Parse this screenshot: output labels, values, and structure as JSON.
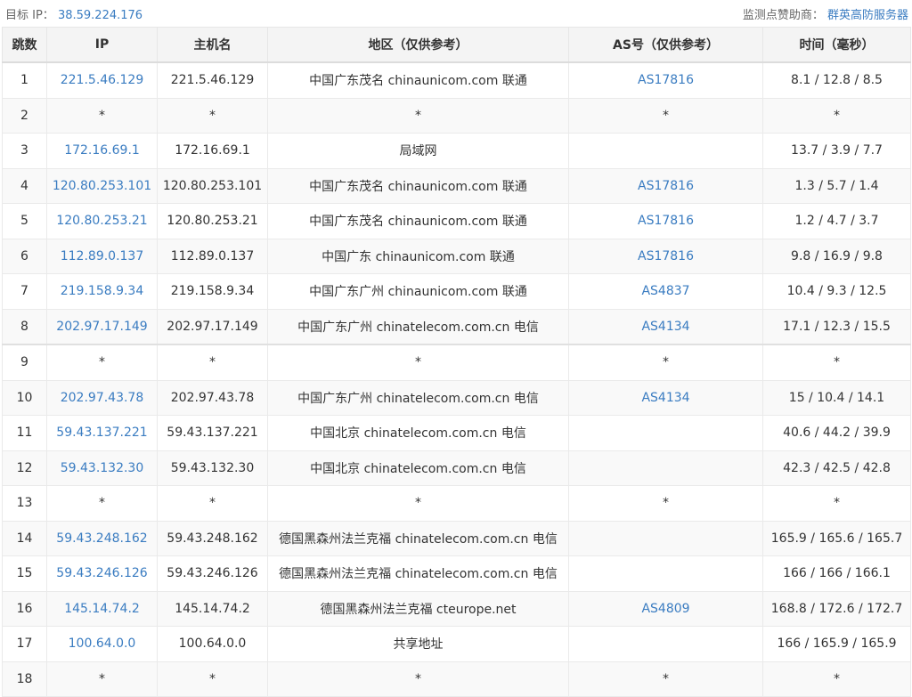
{
  "header": {
    "target_label": "目标 IP：",
    "target_ip": "38.59.224.176",
    "sponsor_label": "监测点赞助商：",
    "sponsor_name": "群英高防服务器"
  },
  "table": {
    "columns": [
      "跳数",
      "IP",
      "主机名",
      "地区（仅供参考）",
      "AS号（仅供参考）",
      "时间（毫秒）"
    ],
    "rows": [
      {
        "hop": "1",
        "ip": "221.5.46.129",
        "host": "221.5.46.129",
        "region": "中国广东茂名 chinaunicom.com 联通",
        "as": "AS17816",
        "time": "8.1 / 12.8 / 8.5"
      },
      {
        "hop": "2",
        "ip": "*",
        "host": "*",
        "region": "*",
        "as": "*",
        "time": "*"
      },
      {
        "hop": "3",
        "ip": "172.16.69.1",
        "host": "172.16.69.1",
        "region": "局域网",
        "as": "",
        "time": "13.7 / 3.9 / 7.7"
      },
      {
        "hop": "4",
        "ip": "120.80.253.101",
        "host": "120.80.253.101",
        "region": "中国广东茂名 chinaunicom.com 联通",
        "as": "AS17816",
        "time": "1.3 / 5.7 / 1.4"
      },
      {
        "hop": "5",
        "ip": "120.80.253.21",
        "host": "120.80.253.21",
        "region": "中国广东茂名 chinaunicom.com 联通",
        "as": "AS17816",
        "time": "1.2 / 4.7 / 3.7"
      },
      {
        "hop": "6",
        "ip": "112.89.0.137",
        "host": "112.89.0.137",
        "region": "中国广东 chinaunicom.com 联通",
        "as": "AS17816",
        "time": "9.8 / 16.9 / 9.8"
      },
      {
        "hop": "7",
        "ip": "219.158.9.34",
        "host": "219.158.9.34",
        "region": "中国广东广州 chinaunicom.com 联通",
        "as": "AS4837",
        "time": "10.4 / 9.3 / 12.5"
      },
      {
        "hop": "8",
        "ip": "202.97.17.149",
        "host": "202.97.17.149",
        "region": "中国广东广州 chinatelecom.com.cn 电信",
        "as": "AS4134",
        "time": "17.1 / 12.3 / 15.5"
      },
      {
        "hop": "9",
        "ip": "*",
        "host": "*",
        "region": "*",
        "as": "*",
        "time": "*"
      },
      {
        "hop": "10",
        "ip": "202.97.43.78",
        "host": "202.97.43.78",
        "region": "中国广东广州 chinatelecom.com.cn 电信",
        "as": "AS4134",
        "time": "15 / 10.4 / 14.1"
      },
      {
        "hop": "11",
        "ip": "59.43.137.221",
        "host": "59.43.137.221",
        "region": "中国北京 chinatelecom.com.cn 电信",
        "as": "",
        "time": "40.6 / 44.2 / 39.9"
      },
      {
        "hop": "12",
        "ip": "59.43.132.30",
        "host": "59.43.132.30",
        "region": "中国北京 chinatelecom.com.cn 电信",
        "as": "",
        "time": "42.3 / 42.5 / 42.8"
      },
      {
        "hop": "13",
        "ip": "*",
        "host": "*",
        "region": "*",
        "as": "*",
        "time": "*"
      },
      {
        "hop": "14",
        "ip": "59.43.248.162",
        "host": "59.43.248.162",
        "region": "德国黑森州法兰克福 chinatelecom.com.cn 电信",
        "as": "",
        "time": "165.9 / 165.6 / 165.7"
      },
      {
        "hop": "15",
        "ip": "59.43.246.126",
        "host": "59.43.246.126",
        "region": "德国黑森州法兰克福 chinatelecom.com.cn 电信",
        "as": "",
        "time": "166 / 166 / 166.1"
      },
      {
        "hop": "16",
        "ip": "145.14.74.2",
        "host": "145.14.74.2",
        "region": "德国黑森州法兰克福 cteurope.net",
        "as": "AS4809",
        "time": "168.8 / 172.6 / 172.7"
      },
      {
        "hop": "17",
        "ip": "100.64.0.0",
        "host": "100.64.0.0",
        "region": "共享地址",
        "as": "",
        "time": "166 / 165.9 / 165.9"
      },
      {
        "hop": "18",
        "ip": "*",
        "host": "*",
        "region": "*",
        "as": "*",
        "time": "*"
      }
    ]
  },
  "colors": {
    "link": "#3a7cc1",
    "header_bg": "#f4f4f4",
    "row_alt": "#f9f9f9",
    "border": "#eaeaea"
  }
}
